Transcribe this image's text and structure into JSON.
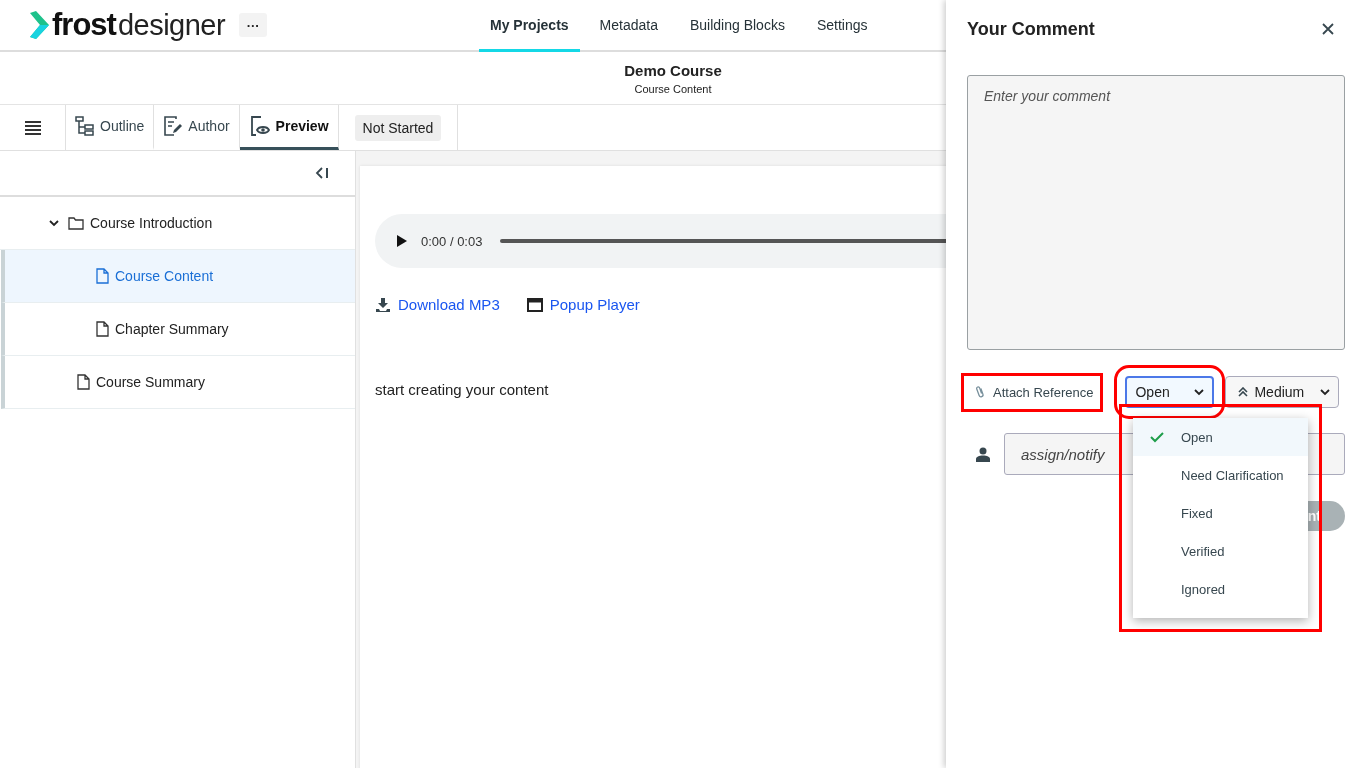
{
  "app": {
    "logo_bold": "frost",
    "logo_light": "designer",
    "more_button": "···"
  },
  "nav": [
    {
      "label": "My Projects",
      "selected": true
    },
    {
      "label": "Metadata",
      "selected": false
    },
    {
      "label": "Building Blocks",
      "selected": false
    },
    {
      "label": "Settings",
      "selected": false
    }
  ],
  "course": {
    "title": "Demo Course",
    "subtitle": "Course Content"
  },
  "toolbar": {
    "tabs": [
      {
        "label": "Outline",
        "kind": "outline",
        "selected": false
      },
      {
        "label": "Author",
        "kind": "author",
        "selected": false
      },
      {
        "label": "Preview",
        "kind": "preview",
        "selected": true
      }
    ],
    "status": "Not Started"
  },
  "tree": [
    {
      "label": "Course Introduction",
      "kind": "folder",
      "expanded": true,
      "selected": false,
      "children": [
        {
          "label": "Course Content",
          "kind": "page",
          "selected": true
        },
        {
          "label": "Chapter Summary",
          "kind": "page",
          "selected": false
        }
      ]
    },
    {
      "label": "Course Summary",
      "kind": "page",
      "selected": false
    }
  ],
  "player": {
    "time": "0:00 / 0:03",
    "level": 0
  },
  "links": [
    {
      "label": "Download MP3",
      "kind": "download"
    },
    {
      "label": "Popup Player",
      "kind": "window"
    }
  ],
  "content_text": "start creating your content",
  "comment_panel": {
    "title": "Your Comment",
    "placeholder": "Enter your comment",
    "attach": {
      "label": "Attach Reference",
      "highlighted": true
    },
    "status": {
      "value": "Open",
      "highlighted": true
    },
    "priority": {
      "value": "Medium"
    },
    "assign_placeholder": "assign/notify",
    "submit": "nt",
    "menu": {
      "highlighted": true,
      "options": [
        {
          "label": "Open",
          "selected": true
        },
        {
          "label": "Need Clarification",
          "selected": false
        },
        {
          "label": "Fixed",
          "selected": false
        },
        {
          "label": "Verified",
          "selected": false
        },
        {
          "label": "Ignored",
          "selected": false
        }
      ]
    }
  }
}
